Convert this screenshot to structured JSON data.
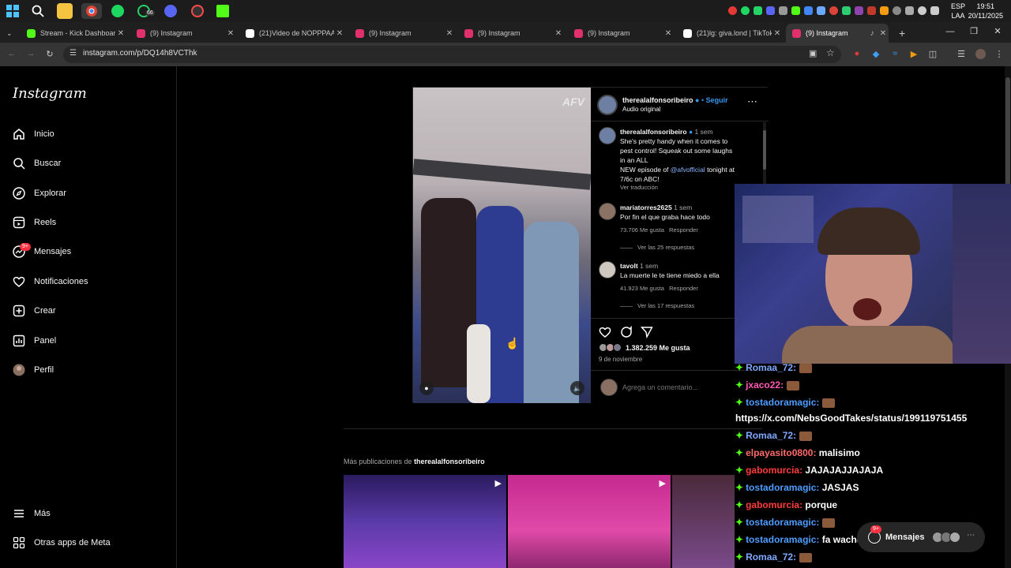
{
  "taskbar": {
    "lang_line1": "ESP",
    "lang_line2": "LAA",
    "time": "19:51",
    "date": "20/11/2025",
    "whatsapp_badge": "66"
  },
  "tabs": [
    {
      "label": "Stream - Kick Dashboard",
      "fav_color": "#53fc18"
    },
    {
      "label": "(9) Instagram",
      "fav_color": "#e1306c"
    },
    {
      "label": "(21)Video de NOPPPAAA",
      "fav_color": "#ffffff"
    },
    {
      "label": "(9) Instagram",
      "fav_color": "#e1306c"
    },
    {
      "label": "(9) Instagram",
      "fav_color": "#e1306c"
    },
    {
      "label": "(9) Instagram",
      "fav_color": "#e1306c"
    },
    {
      "label": "(21)lg: giva.lond | TikTok",
      "fav_color": "#ffffff"
    },
    {
      "label": "(9) Instagram",
      "fav_color": "#e1306c"
    }
  ],
  "address": {
    "url": "instagram.com/p/DQ14h8VCThk"
  },
  "sidebar": {
    "logo": "Instagram",
    "items": [
      {
        "label": "Inicio",
        "icon": "home-icon"
      },
      {
        "label": "Buscar",
        "icon": "search-icon"
      },
      {
        "label": "Explorar",
        "icon": "compass-icon"
      },
      {
        "label": "Reels",
        "icon": "reels-icon"
      },
      {
        "label": "Mensajes",
        "icon": "messenger-icon",
        "badge": "9+"
      },
      {
        "label": "Notificaciones",
        "icon": "heart-icon"
      },
      {
        "label": "Crear",
        "icon": "plus-square-icon"
      },
      {
        "label": "Panel",
        "icon": "dashboard-icon"
      },
      {
        "label": "Perfil",
        "icon": "profile-avatar"
      }
    ],
    "more": "Más",
    "meta_apps": "Otras apps de Meta"
  },
  "post": {
    "watermark": "AFV",
    "author": "therealalfonsoribeiro",
    "follow": "Seguir",
    "audio": "Audio original",
    "caption_time": "1 sem",
    "caption_line1": "She's pretty handy when it comes to",
    "caption_line2": "pest control! Squeak out some laughs",
    "caption_line3": "in an ALL",
    "caption_line4a": "NEW episode of ",
    "caption_mention": "@afvofficial",
    "caption_line4b": " tonight at",
    "caption_line5": "7/6c on ABC!",
    "see_translation": "Ver traducción",
    "comments": [
      {
        "user": "mariatorres2625",
        "time": "1 sem",
        "text": "Por fin el que graba hace todo",
        "likes": "73.706 Me gusta",
        "reply": "Responder",
        "view_replies": "Ver las 25 respuestas"
      },
      {
        "user": "tavolt",
        "time": "1 sem",
        "text": "La muerte le te tiene miedo a ella",
        "likes": "41.923 Me gusta",
        "reply": "Responder",
        "view_replies": "Ver las 17 respuestas"
      }
    ],
    "likes": "1.382.259 Me gusta",
    "date": "9 de noviembre",
    "comment_placeholder": "Agrega un comentario..."
  },
  "more_posts": {
    "prefix": "Más publicaciones de ",
    "user": "therealalfonsoribeiro"
  },
  "chat": [
    {
      "user": "Romaa_72:",
      "msg": "",
      "color": "#7fa8ff"
    },
    {
      "user": "jxaco22:",
      "msg": "",
      "color": "#ff5ab4"
    },
    {
      "user": "tostadoramagic:",
      "msg": "",
      "color": "#4f9cff"
    },
    {
      "user": "",
      "msg": "https://x.com/NebsGoodTakes/status/199119751455",
      "color": "#ffffff"
    },
    {
      "user": "Romaa_72:",
      "msg": "",
      "color": "#7fa8ff"
    },
    {
      "user": "elpayasito0800:",
      "msg": " malisimo",
      "color": "#ff6b6b"
    },
    {
      "user": "gabomurcia:",
      "msg": " JAJAJAJJAJAJA",
      "color": "#ff3b3b"
    },
    {
      "user": "tostadoramagic:",
      "msg": " JASJAS",
      "color": "#4f9cff"
    },
    {
      "user": "gabomurcia:",
      "msg": " porque",
      "color": "#ff3b3b"
    },
    {
      "user": "tostadoramagic:",
      "msg": "",
      "color": "#4f9cff"
    },
    {
      "user": "tostadoramagic:",
      "msg": " fa wacho",
      "color": "#4f9cff"
    },
    {
      "user": "Romaa_72:",
      "msg": "",
      "color": "#7fa8ff"
    }
  ],
  "messages_pill": {
    "label": "Mensajes",
    "badge": "9+"
  }
}
